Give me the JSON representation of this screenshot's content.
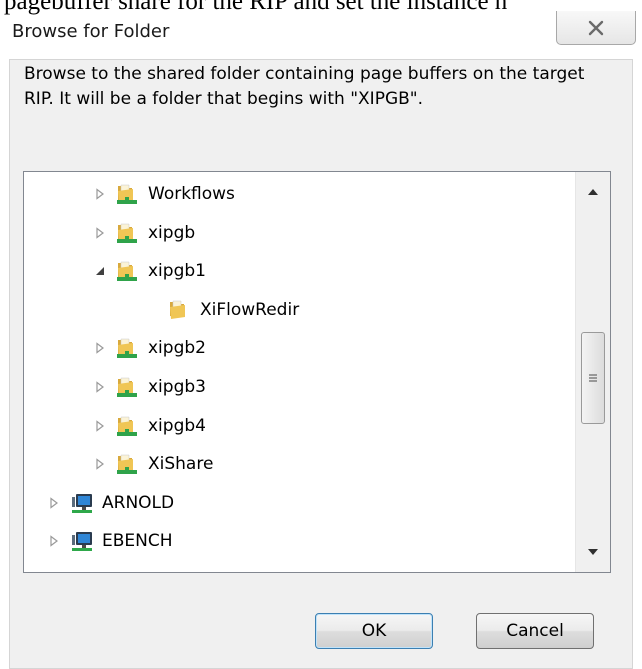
{
  "document_text": "pagebuffer share for the RIP and set the instance n",
  "dialog": {
    "title": "Browse for Folder",
    "close_glyph": "✕",
    "description": "Browse to the shared folder containing page buffers on the target RIP. It will be a folder that begins with \"XIPGB\".",
    "tree_items": [
      {
        "label": "Workflows",
        "level": 1,
        "expander": "collapsed",
        "icon": "shared-folder-icon"
      },
      {
        "label": "xipgb",
        "level": 1,
        "expander": "collapsed",
        "icon": "shared-folder-icon"
      },
      {
        "label": "xipgb1",
        "level": 1,
        "expander": "expanded",
        "icon": "shared-folder-icon"
      },
      {
        "label": "XiFlowRedir",
        "level": 2,
        "expander": "none",
        "icon": "folder-icon"
      },
      {
        "label": "xipgb2",
        "level": 1,
        "expander": "collapsed",
        "icon": "shared-folder-icon"
      },
      {
        "label": "xipgb3",
        "level": 1,
        "expander": "collapsed",
        "icon": "shared-folder-icon"
      },
      {
        "label": "xipgb4",
        "level": 1,
        "expander": "collapsed",
        "icon": "shared-folder-icon"
      },
      {
        "label": "XiShare",
        "level": 1,
        "expander": "collapsed",
        "icon": "shared-folder-icon"
      },
      {
        "label": "ARNOLD",
        "level": 0,
        "expander": "collapsed",
        "icon": "computer-icon"
      },
      {
        "label": "EBENCH",
        "level": 0,
        "expander": "collapsed",
        "icon": "computer-icon"
      }
    ],
    "ok_label": "OK",
    "cancel_label": "Cancel"
  }
}
